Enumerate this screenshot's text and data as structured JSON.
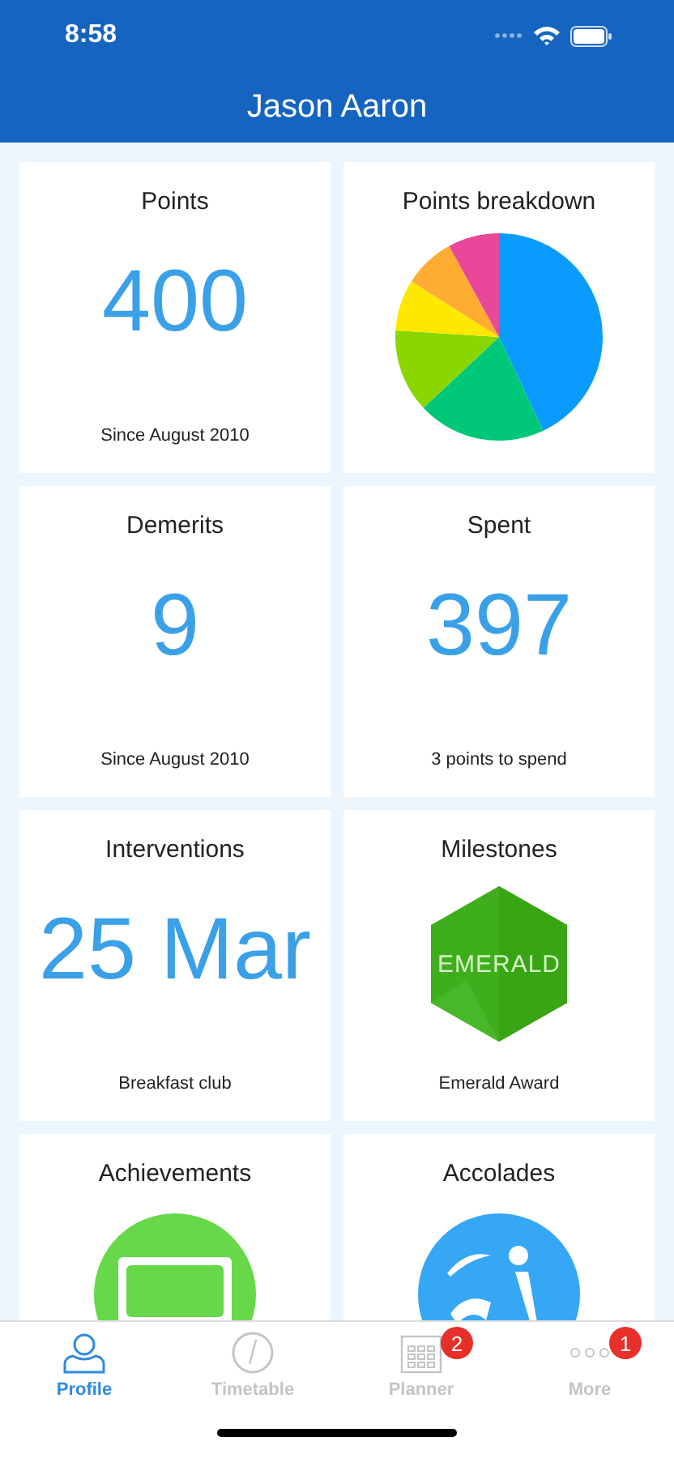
{
  "status_bar": {
    "time": "8:58"
  },
  "header": {
    "title": "Jason Aaron"
  },
  "cards": [
    {
      "kind": "number",
      "title": "Points",
      "value": "400",
      "caption": "Since August 2010"
    },
    {
      "kind": "pie",
      "title": "Points breakdown"
    },
    {
      "kind": "number",
      "title": "Demerits",
      "value": "9",
      "caption": "Since August 2010"
    },
    {
      "kind": "number",
      "title": "Spent",
      "value": "397",
      "caption": "3 points to spend"
    },
    {
      "kind": "number",
      "title": "Interventions",
      "value": "25 Mar",
      "caption": "Breakfast club"
    },
    {
      "kind": "badge",
      "title": "Milestones",
      "badge": "EMERALD",
      "caption": "Emerald Award"
    },
    {
      "kind": "monitor",
      "title": "Achievements"
    },
    {
      "kind": "bowler",
      "title": "Accolades"
    }
  ],
  "tabs": [
    {
      "kind": "profile",
      "label": "Profile",
      "selected": true
    },
    {
      "kind": "clock",
      "label": "Timetable",
      "selected": false
    },
    {
      "kind": "calendar",
      "label": "Planner",
      "selected": false,
      "badge": "2"
    },
    {
      "kind": "more",
      "label": "More",
      "selected": false,
      "badge": "1"
    }
  ]
}
